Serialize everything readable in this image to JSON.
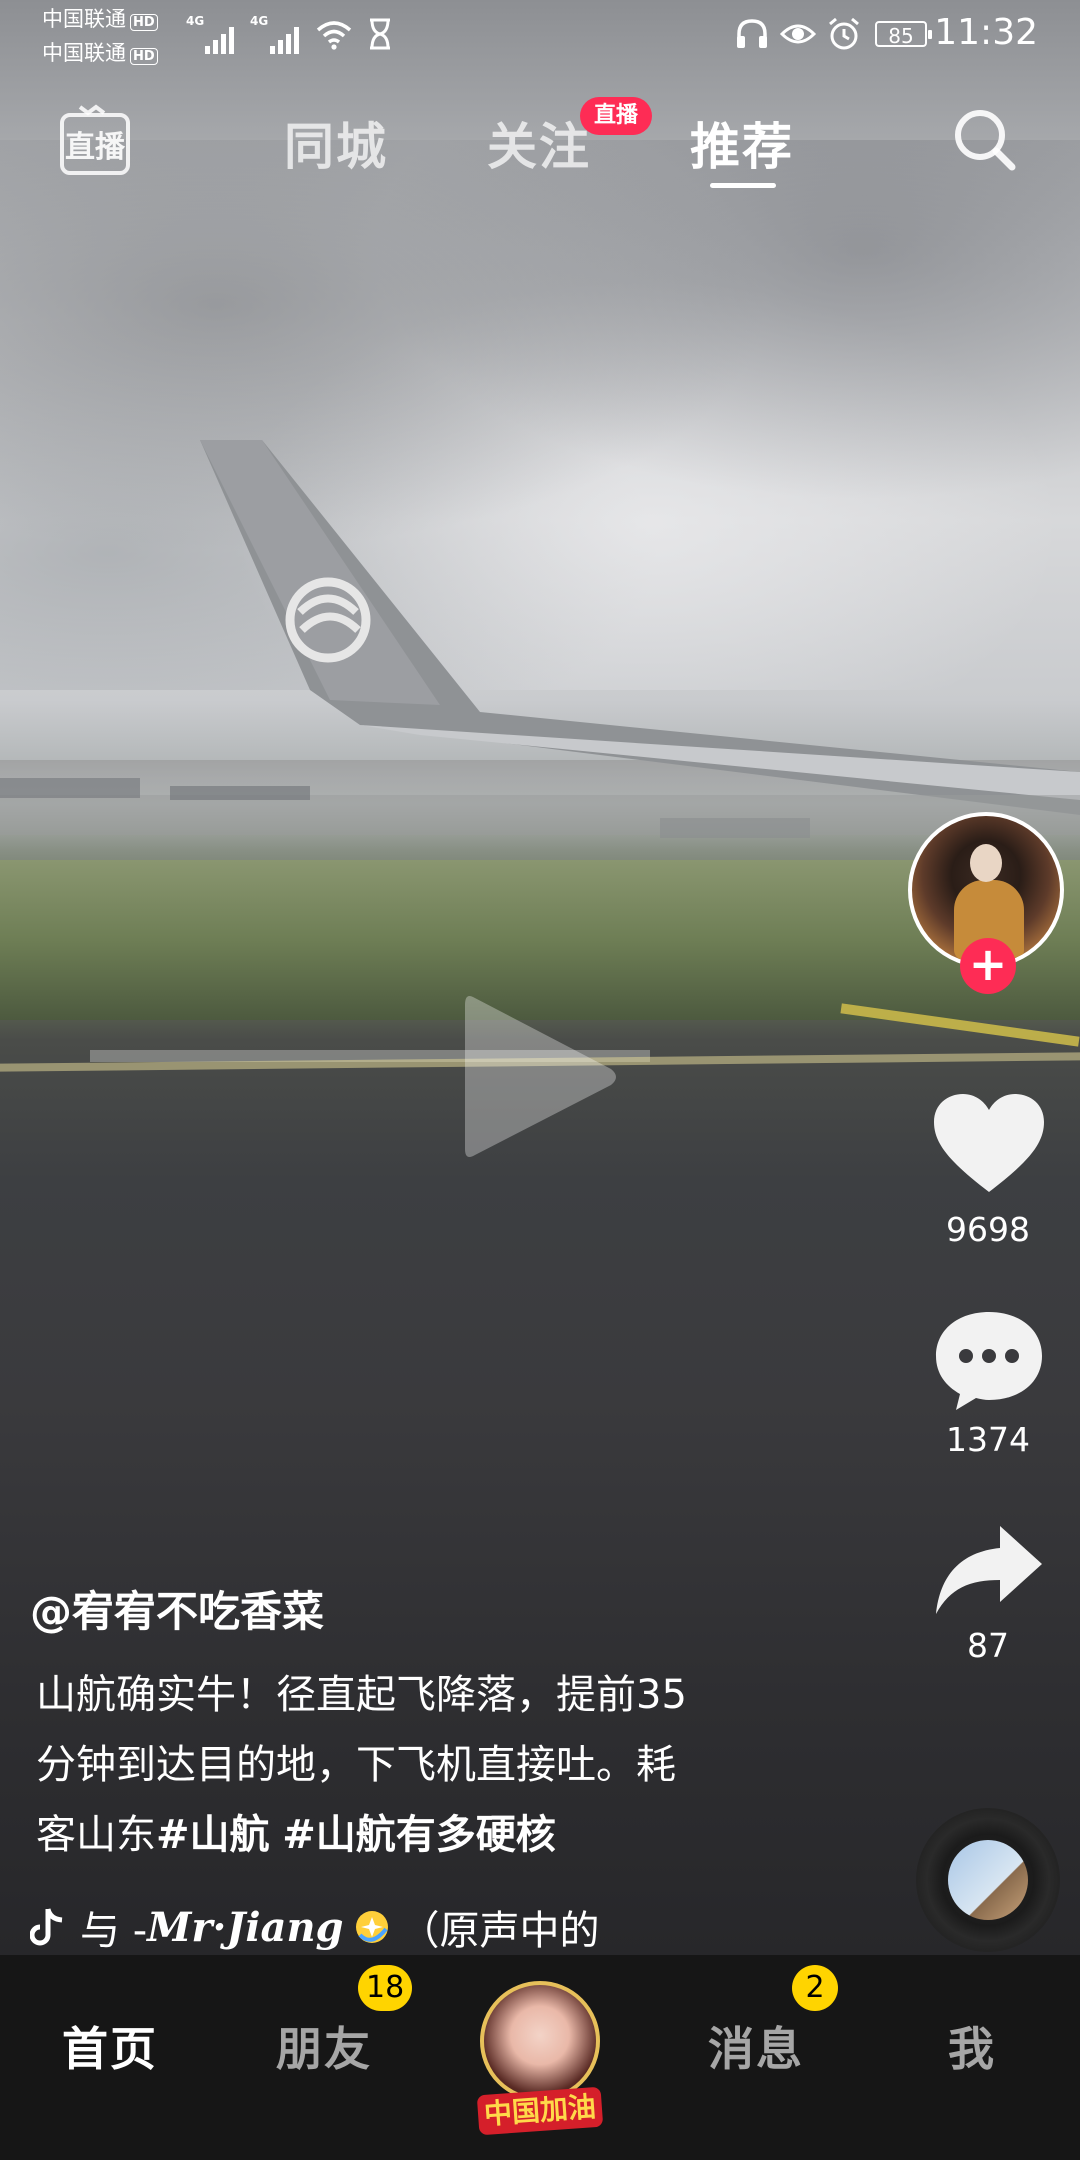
{
  "status_bar": {
    "carrier1": "中国联通",
    "carrier2": "中国联通",
    "hd": "HD",
    "net1": "4G",
    "net2": "4G",
    "battery": "85",
    "time": "11:32"
  },
  "top_tabs": {
    "live_label": "直播",
    "items": [
      {
        "label": "同城"
      },
      {
        "label": "关注",
        "badge": "直播"
      },
      {
        "label": "推荐"
      }
    ],
    "active": "推荐"
  },
  "rail": {
    "likes": "9698",
    "comments": "1374",
    "shares": "87"
  },
  "post": {
    "author": "@宥宥不吃香菜",
    "desc_line1": "山航确实牛！径直起飞降落，提前35",
    "desc_line2": "分钟到达目的地，下飞机直接吐。耗",
    "desc_line3_prefix": "客山东",
    "tag1": "#山航",
    "tag2": "#山航有多硬核",
    "music_prefix": "与 - ",
    "music_artist": "Mr·Jiang",
    "music_suffix": "（原声中的"
  },
  "bottom_nav": {
    "items": [
      {
        "label": "首页"
      },
      {
        "label": "朋友",
        "badge": "18"
      },
      {
        "label": "消息",
        "badge": "2"
      },
      {
        "label": "我"
      }
    ],
    "center_label": "中国加油"
  },
  "colors": {
    "accent_red": "#fe2c55",
    "badge_yellow": "#ffd400"
  }
}
